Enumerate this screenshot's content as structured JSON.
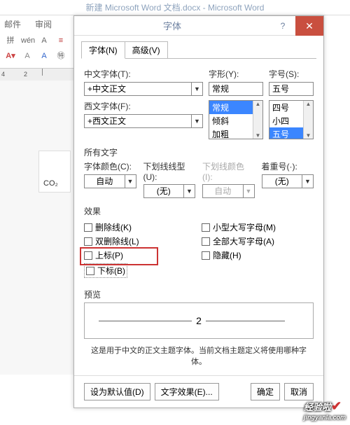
{
  "app": {
    "title": "新建 Microsoft Word 文档.docx - Microsoft Word"
  },
  "ribbon": {
    "tab_mail": "邮件",
    "tab_review": "审阅",
    "ruler_2": "2",
    "ruler_4": "4",
    "doc_text": "CO₂"
  },
  "dialog": {
    "title": "字体",
    "help": "?",
    "close": "✕",
    "tabs": {
      "font": "字体(N)",
      "advanced": "高级(V)"
    },
    "cn_font_label": "中文字体(T):",
    "cn_font_value": "+中文正文",
    "en_font_label": "西文字体(F):",
    "en_font_value": "+西文正文",
    "style_label": "字形(Y):",
    "style_value": "常规",
    "style_items": [
      "常规",
      "倾斜",
      "加粗"
    ],
    "size_label": "字号(S):",
    "size_value": "五号",
    "size_items": [
      "四号",
      "小四",
      "五号"
    ],
    "all_text": "所有文字",
    "color_label": "字体颜色(C):",
    "color_value": "自动",
    "uline_label": "下划线线型(U):",
    "uline_value": "(无)",
    "uline_color_label": "下划线颜色(I):",
    "uline_color_value": "自动",
    "emph_label": "着重号(·):",
    "emph_value": "(无)",
    "effects": "效果",
    "eff": {
      "strike": "删除线(K)",
      "dstrike": "双删除线(L)",
      "super": "上标(P)",
      "sub": "下标(B)",
      "smallcaps": "小型大写字母(M)",
      "allcaps": "全部大写字母(A)",
      "hidden": "隐藏(H)"
    },
    "preview_label": "预览",
    "preview_value": "2",
    "note": "这是用于中文的正文主题字体。当前文档主题定义将使用哪种字体。",
    "btn_default": "设为默认值(D)",
    "btn_texteff": "文字效果(E)...",
    "btn_ok": "确定",
    "btn_cancel": "取消"
  },
  "watermark": "经验啦"
}
